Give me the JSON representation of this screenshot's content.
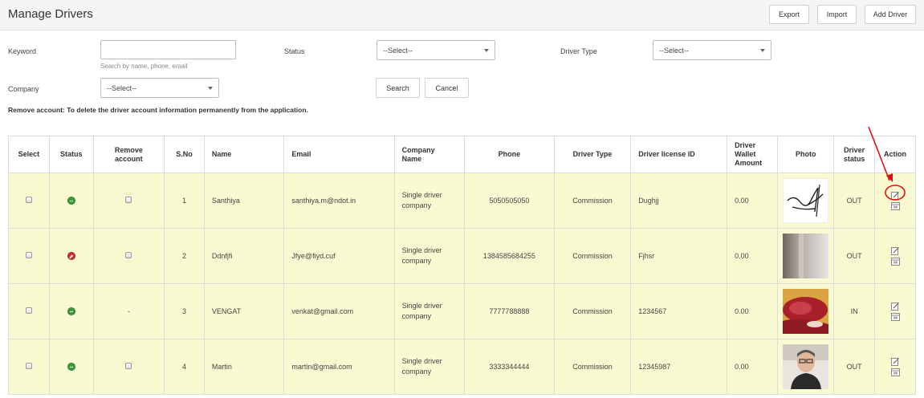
{
  "header": {
    "title": "Manage Drivers",
    "buttons": {
      "export": "Export",
      "import": "Import",
      "add": "Add Driver"
    }
  },
  "filters": {
    "keyword_label": "Keyword",
    "keyword_value": "",
    "keyword_hint": "Search by name, phone, email",
    "status_label": "Status",
    "status_value": "--Select--",
    "driver_type_label": "Driver Type",
    "driver_type_value": "--Select--",
    "company_label": "Company",
    "company_value": "--Select--",
    "search_label": "Search",
    "cancel_label": "Cancel"
  },
  "note": "Remove account: To delete the driver account information permanently from the application.",
  "table": {
    "headers": {
      "select": "Select",
      "status": "Status",
      "remove": "Remove account",
      "sno": "S.No",
      "name": "Name",
      "email": "Email",
      "company": "Company Name",
      "phone": "Phone",
      "driver_type": "Driver Type",
      "license": "Driver license ID",
      "wallet": "Driver Wallet Amount",
      "photo": "Photo",
      "driver_status": "Driver status",
      "action": "Action"
    },
    "rows": [
      {
        "sno": "1",
        "status": "active",
        "remove": "checkbox",
        "name": "Santhiya",
        "email": "santhiya.m@ndot.in",
        "company": "Single driver company",
        "phone": "5050505050",
        "driver_type": "Commission",
        "license": "Dughjj",
        "wallet": "0.00",
        "photo": "signature-photo",
        "driver_status": "OUT"
      },
      {
        "sno": "2",
        "status": "blocked",
        "remove": "checkbox",
        "name": "Ddnfjfi",
        "email": "Jfye@fiyd.cuf",
        "company": "Single driver company",
        "phone": "1384585684255",
        "driver_type": "Commission",
        "license": "Fjhsr",
        "wallet": "0.00",
        "photo": "wall-photo",
        "driver_status": "OUT"
      },
      {
        "sno": "3",
        "status": "active",
        "remove": "-",
        "name": "VENGAT",
        "email": "venkat@gmail.com",
        "company": "Single driver company",
        "phone": "7777788888",
        "driver_type": "Commission",
        "license": "1234567",
        "wallet": "0.00",
        "photo": "meat-photo",
        "driver_status": "IN"
      },
      {
        "sno": "4",
        "status": "active",
        "remove": "checkbox",
        "name": "Martin",
        "email": "martin@gmail.com",
        "company": "Single driver company",
        "phone": "3333344444",
        "driver_type": "Commission",
        "license": "12345987",
        "wallet": "0.00",
        "photo": "portrait-photo",
        "driver_status": "OUT"
      }
    ]
  },
  "colors": {
    "row_bg": "#fafad2",
    "link_red": "#e8574a",
    "active": "#3a9d3a",
    "blocked": "#cf2d2d",
    "annotation": "#e01010"
  },
  "icons": {
    "edit": "edit-icon",
    "view": "view-icon"
  }
}
